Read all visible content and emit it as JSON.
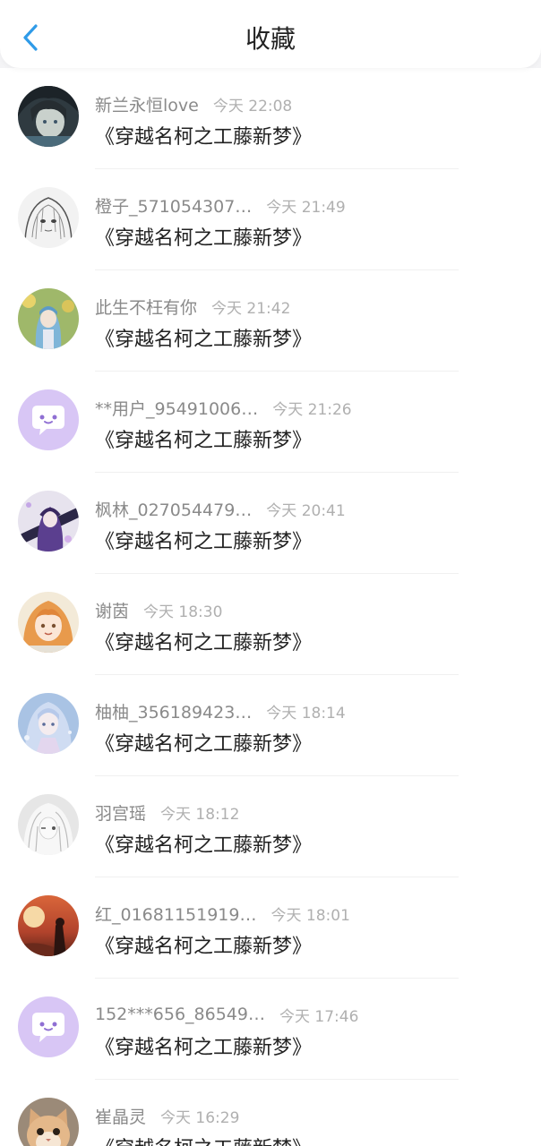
{
  "header": {
    "title": "收藏"
  },
  "items": [
    {
      "name": "新兰永恒love",
      "time": "今天 22:08",
      "book": "《穿越名柯之工藤新梦》",
      "avatar": "anime-avatar-dark"
    },
    {
      "name": "橙子_571054307…",
      "time": "今天 21:49",
      "book": "《穿越名柯之工藤新梦》",
      "avatar": "anime-avatar-sketch"
    },
    {
      "name": "此生不枉有你",
      "time": "今天 21:42",
      "book": "《穿越名柯之工藤新梦》",
      "avatar": "anime-avatar-blue-hair"
    },
    {
      "name": "**用户_95491006…",
      "time": "今天 21:26",
      "book": "《穿越名柯之工藤新梦》",
      "avatar": "default-chat-avatar"
    },
    {
      "name": "枫林_027054479…",
      "time": "今天 20:41",
      "book": "《穿越名柯之工藤新梦》",
      "avatar": "anime-avatar-purple"
    },
    {
      "name": "谢茵",
      "time": "今天 18:30",
      "book": "《穿越名柯之工藤新梦》",
      "avatar": "anime-avatar-orange-hair"
    },
    {
      "name": "柚柚_356189423…",
      "time": "今天 18:14",
      "book": "《穿越名柯之工藤新梦》",
      "avatar": "anime-avatar-light-blue"
    },
    {
      "name": "羽宫瑶",
      "time": "今天 18:12",
      "book": "《穿越名柯之工藤新梦》",
      "avatar": "anime-avatar-white-hair"
    },
    {
      "name": "红_01681151919…",
      "time": "今天 18:01",
      "book": "《穿越名柯之工藤新梦》",
      "avatar": "sunset-avatar"
    },
    {
      "name": "152***656_86549…",
      "time": "今天 17:46",
      "book": "《穿越名柯之工藤新梦》",
      "avatar": "default-chat-avatar"
    },
    {
      "name": "崔晶灵",
      "time": "今天 16:29",
      "book": "《穿越名柯之工藤新梦》",
      "avatar": "cat-avatar"
    }
  ],
  "colors": {
    "accent": "#2f9be8",
    "default_avatar_bg": "#d8c6f5",
    "name_text": "#8a8a8a",
    "time_text": "#b0b0b0"
  }
}
